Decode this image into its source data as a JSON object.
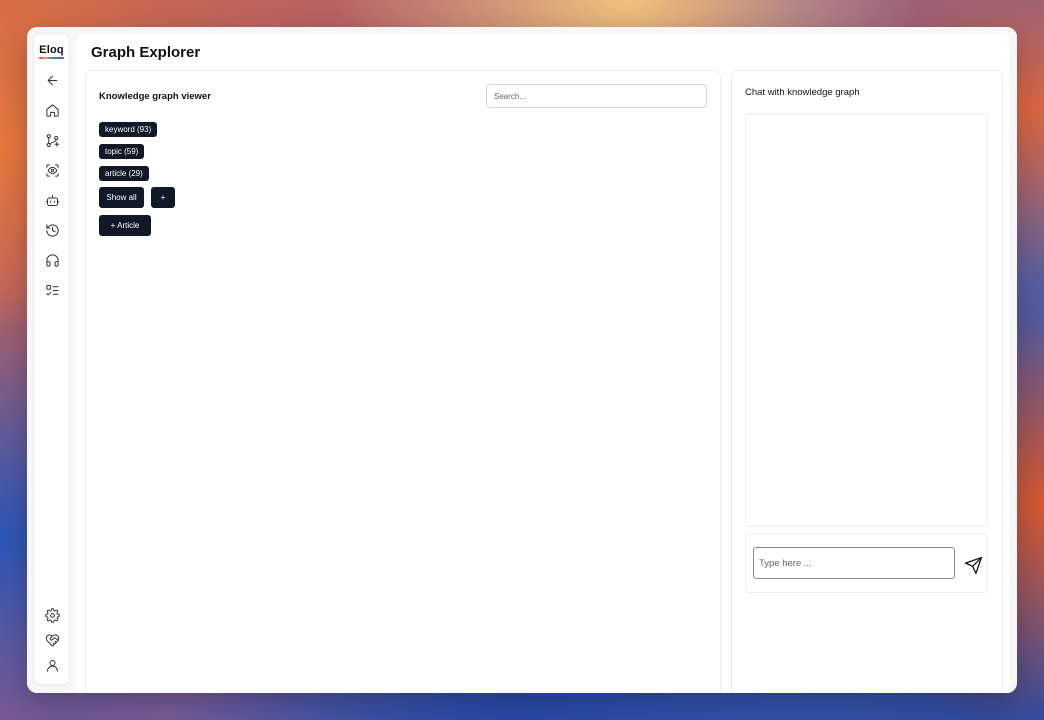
{
  "app": {
    "logo": "Eloq"
  },
  "page": {
    "title": "Graph Explorer"
  },
  "sidebar": {
    "top_items": [
      {
        "icon": "arrow-left-icon"
      },
      {
        "icon": "home-icon"
      },
      {
        "icon": "git-branch-plus-icon"
      },
      {
        "icon": "scan-eye-icon"
      },
      {
        "icon": "bot-icon"
      },
      {
        "icon": "history-icon"
      },
      {
        "icon": "headphones-icon"
      },
      {
        "icon": "list-checks-icon"
      }
    ],
    "bottom_items": [
      {
        "icon": "gear-icon"
      },
      {
        "icon": "heart-handshake-icon"
      },
      {
        "icon": "user-icon"
      }
    ]
  },
  "viewer": {
    "title": "Knowledge graph viewer",
    "search_placeholder": "Search...",
    "filters": [
      {
        "label": "keyword (93)"
      },
      {
        "label": "topic (59)"
      },
      {
        "label": "article (29)"
      }
    ],
    "show_all_label": "Show all",
    "plus_label": "+",
    "add_article_label": "+ Article"
  },
  "chat": {
    "title": "Chat with knowledge graph",
    "input_placeholder": "Type here ...",
    "send_icon": "send-icon"
  },
  "colors": {
    "button_bg": "#111827",
    "button_text": "#ffffff"
  }
}
